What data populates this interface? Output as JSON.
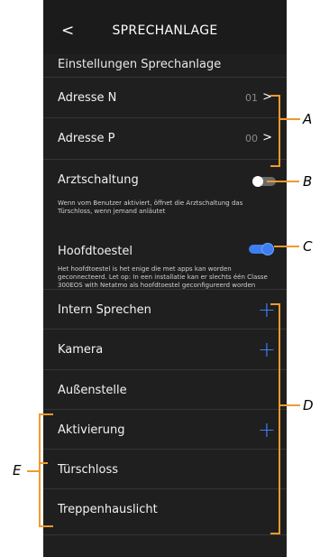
{
  "header": {
    "back_icon": "chevron-left-icon",
    "back_glyph": "<",
    "title": "SPRECHANLAGE"
  },
  "section_title": "Einstellungen Sprechanlage",
  "address_rows": [
    {
      "label": "Adresse N",
      "value": "01"
    },
    {
      "label": "Adresse P",
      "value": "00"
    }
  ],
  "arzt": {
    "label": "Arztschaltung",
    "enabled": false,
    "description": "Wenn vom Benutzer aktiviert, öffnet die Arztschaltung das Türschloss, wenn jemand anläutet"
  },
  "hoofd": {
    "label": "Hoofdtoestel",
    "enabled": true,
    "description": "Het hoofdtoestel is het enige die met apps kan worden geconnecteerd. Let op: In een installatie kan er slechts één Classe 300EOS with Netatmo als hoofdtoestel geconfigureerd worden"
  },
  "list_rows": [
    {
      "label": "Intern Sprechen",
      "has_add": true
    },
    {
      "label": "Kamera",
      "has_add": true
    },
    {
      "label": "Außenstelle",
      "has_add": false
    },
    {
      "label": "Aktivierung",
      "has_add": true
    },
    {
      "label": "Türschloss",
      "has_add": false
    },
    {
      "label": "Treppenhauslicht",
      "has_add": false
    }
  ],
  "glyphs": {
    "chevron": ">",
    "plus": "+"
  },
  "callouts": {
    "A": "A",
    "B": "B",
    "C": "C",
    "D": "D",
    "E": "E"
  },
  "colors": {
    "accent": "#3d7ff0",
    "callout_line": "#f0992f",
    "background": "#1f1f1f"
  }
}
